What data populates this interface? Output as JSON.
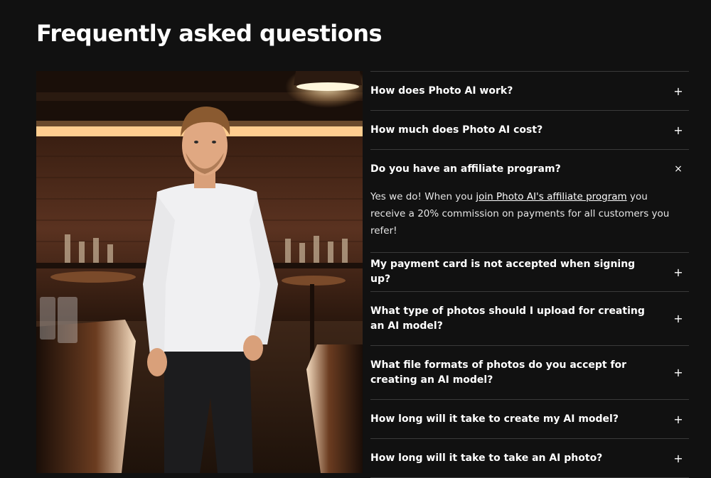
{
  "page": {
    "title": "Frequently asked questions"
  },
  "faq": {
    "items": [
      {
        "question": "How does Photo AI work?",
        "icon": "+",
        "state": "collapsed"
      },
      {
        "question": "How much does Photo AI cost?",
        "icon": "+",
        "state": "collapsed"
      },
      {
        "question": "Do you have an affiliate program?",
        "icon": "×",
        "state": "expanded",
        "answer_before": "Yes we do! When you ",
        "answer_link": "join Photo AI's affiliate program",
        "answer_after": " you receive a 20% commission on payments for all customers you refer!"
      },
      {
        "question": "My payment card is not accepted when signing up?",
        "icon": "+",
        "state": "collapsed"
      },
      {
        "question": "What type of photos should I upload for creating an AI model?",
        "icon": "+",
        "state": "collapsed"
      },
      {
        "question": "What file formats of photos do you accept for creating an AI model?",
        "icon": "+",
        "state": "collapsed"
      },
      {
        "question": "How long will it take to create my AI model?",
        "icon": "+",
        "state": "collapsed"
      },
      {
        "question": "How long will it take to take an AI photo?",
        "icon": "+",
        "state": "collapsed"
      }
    ]
  },
  "colors": {
    "background": "#111111",
    "text": "#ffffff",
    "divider": "#3a3a3a"
  }
}
